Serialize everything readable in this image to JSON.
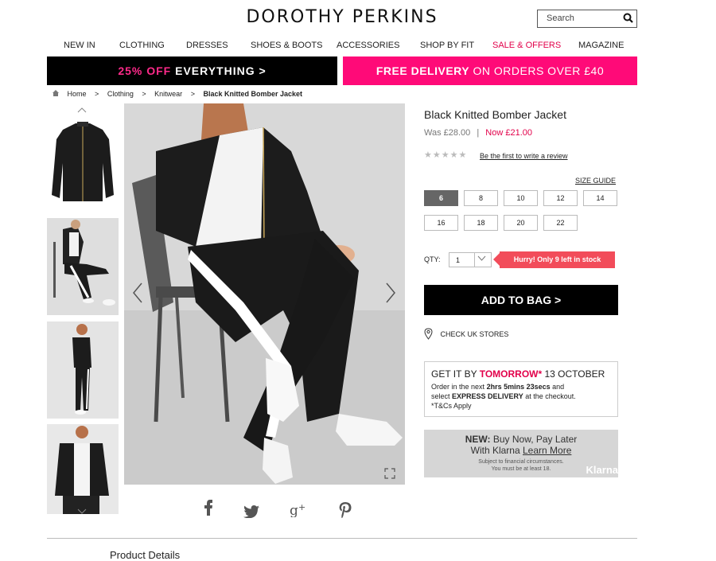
{
  "brand": "DOROTHY PERKINS",
  "search": {
    "placeholder": "Search"
  },
  "nav": [
    "NEW IN",
    "CLOTHING",
    "DRESSES",
    "SHOES & BOOTS",
    "ACCESSORIES",
    "SHOP BY FIT",
    "SALE & OFFERS",
    "MAGAZINE"
  ],
  "banners": {
    "left_pink": "25% OFF",
    "left_white": "EVERYTHING >",
    "right_bold": "FREE DELIVERY",
    "right_rest": "ON ORDERS OVER £40"
  },
  "breadcrumb": [
    ">",
    "Home",
    "Clothing",
    "Knitwear",
    "Black Knitted Bomber Jacket"
  ],
  "product": {
    "title": "Black Knitted Bomber Jacket",
    "was": "Was £28.00",
    "sep": "|",
    "now": "Now £21.00",
    "stars": "★★★★★",
    "review_link": "Be the first to write a review",
    "size_guide": "SIZE GUIDE",
    "sizes": [
      "6",
      "8",
      "10",
      "12",
      "14",
      "16",
      "18",
      "20",
      "22"
    ],
    "selected_size": "6",
    "qty_label": "QTY:",
    "qty_value": "1",
    "stock_msg": "Hurry! Only 9 left in stock",
    "add_to_bag": "ADD TO BAG >",
    "check_stores": "CHECK UK STORES"
  },
  "delivery": {
    "get_it": "GET IT BY",
    "tomorrow": "TOMORROW*",
    "date": "13 OCTOBER",
    "line1_pre": "Order in the next",
    "countdown": "2hrs 5mins 23secs",
    "line1_post": "and",
    "line2_pre": "select",
    "express": "EXPRESS DELIVERY",
    "line2_post": "at the checkout.",
    "tcs": "*T&Cs Apply"
  },
  "klarna": {
    "new": "NEW:",
    "line1": "Buy Now, Pay Later",
    "line2": "With Klarna",
    "learn": "Learn More",
    "sub1": "Subject to financial circumstances.",
    "sub2": "You must be at least 18.",
    "logo": "Klarna"
  },
  "social": [
    "f",
    "t",
    "g+",
    "p"
  ],
  "section_title": "Product Details",
  "colors": {
    "sale_pink": "#ff0a78",
    "price_red": "#e2004a",
    "stock_red": "#f24c5a",
    "black": "#000000"
  }
}
